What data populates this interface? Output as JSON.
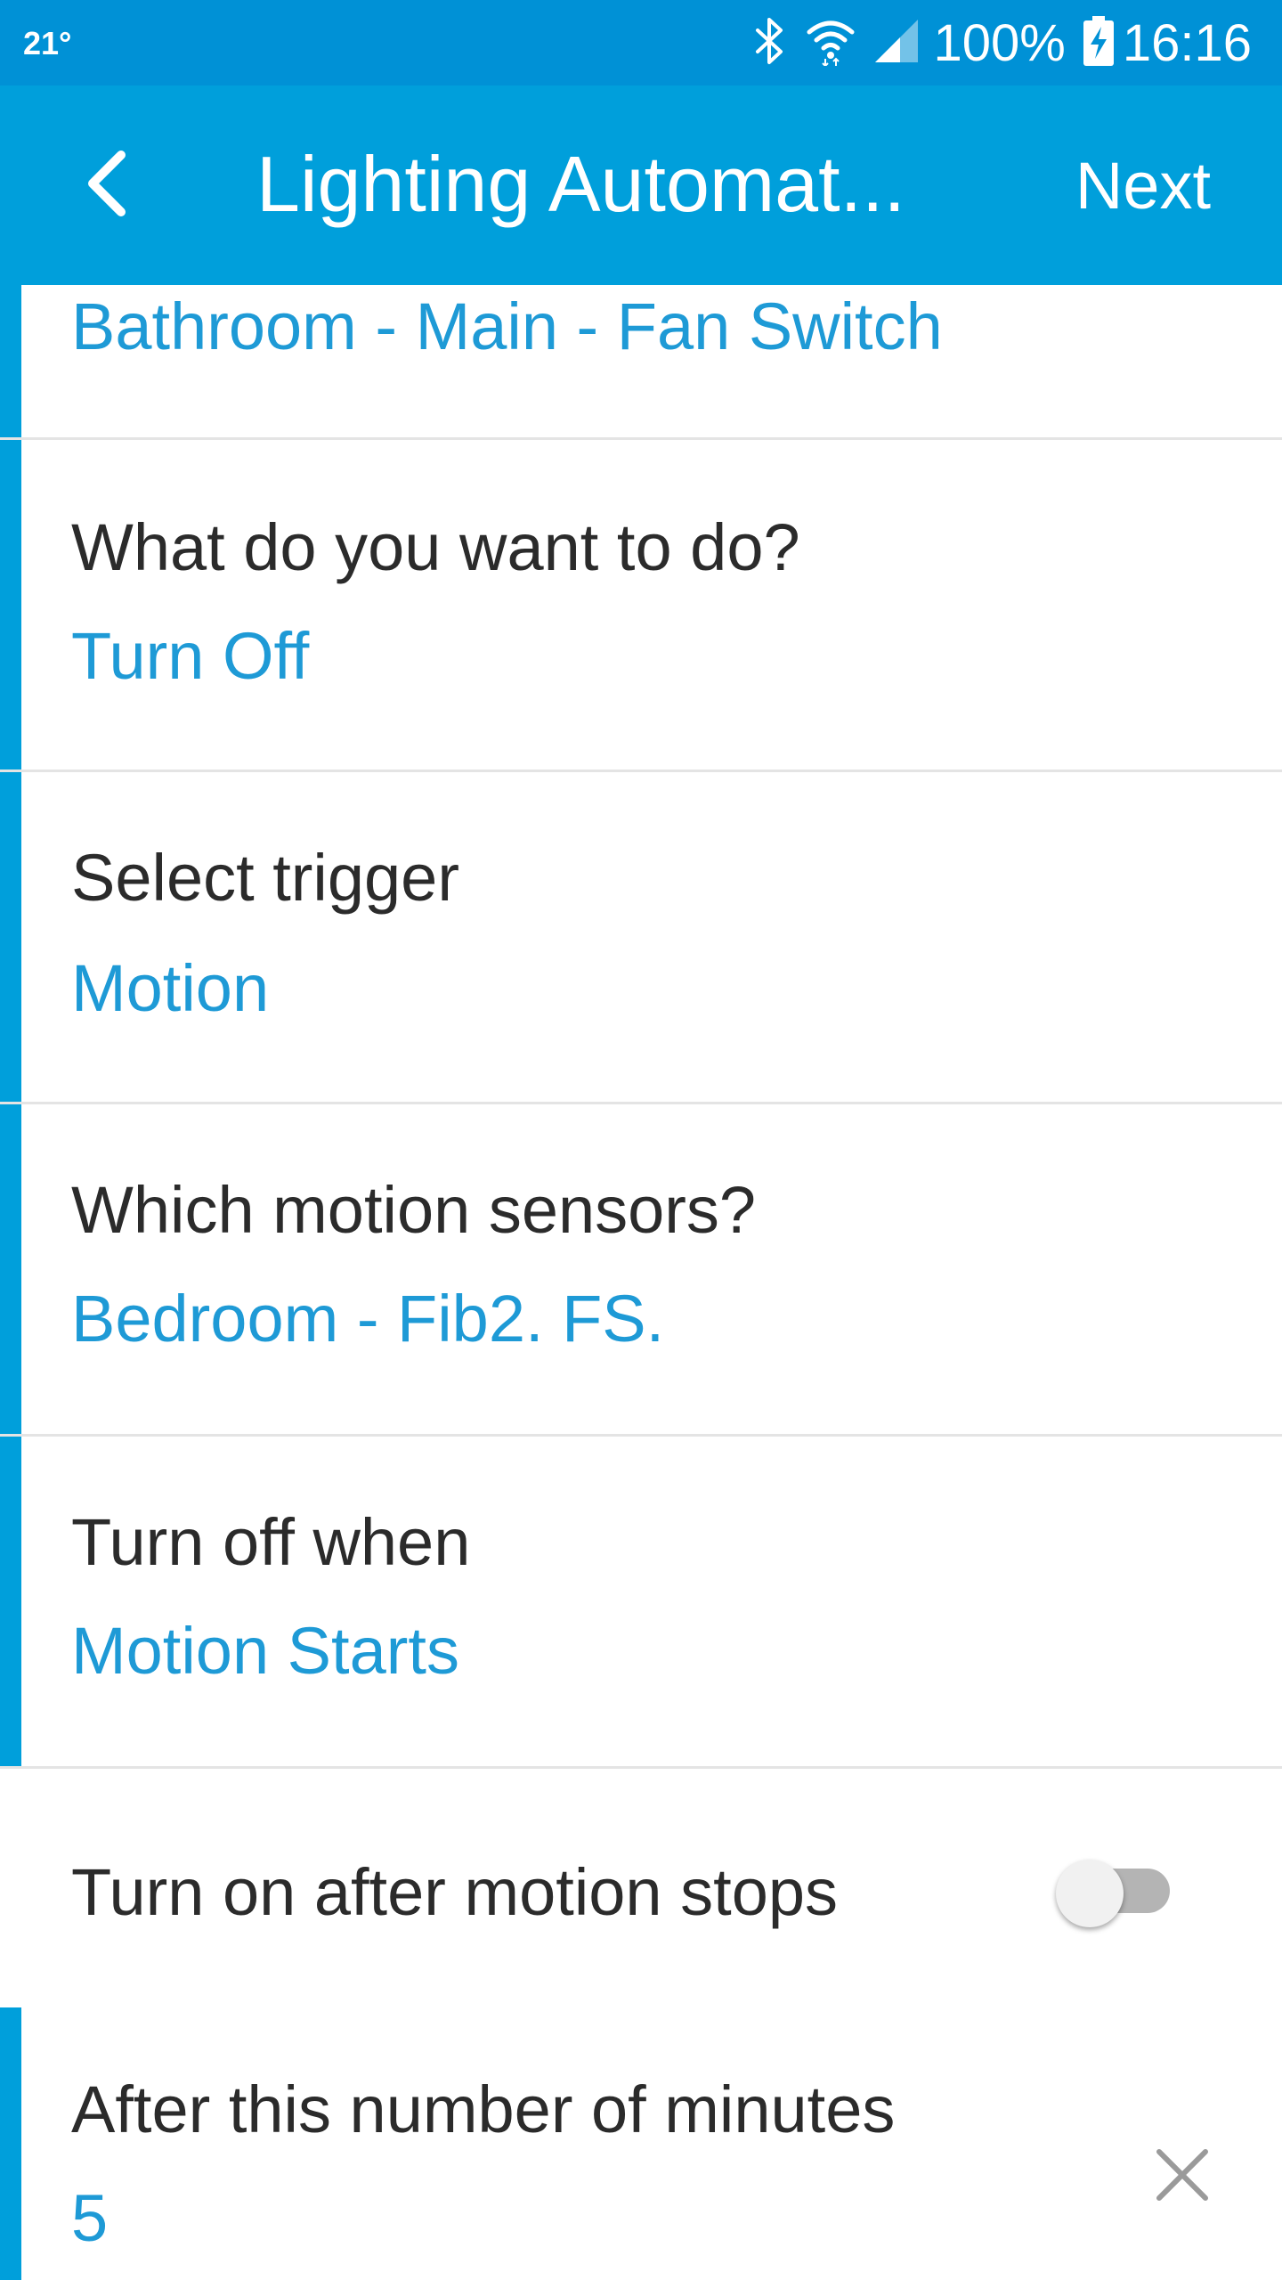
{
  "status_bar": {
    "temperature": "21°",
    "battery_percent": "100%",
    "time": "16:16",
    "icons": [
      "bluetooth-icon",
      "wifi-icon",
      "signal-icon",
      "battery-charging-icon"
    ]
  },
  "app_bar": {
    "back_icon": "chevron-left-icon",
    "title": "Lighting Automat...",
    "next_label": "Next"
  },
  "colors": {
    "status_bar": "#0091d6",
    "app_bar": "#009fdb",
    "accent": "#009fdb",
    "value_text": "#1e9ad6",
    "label_text": "#2b2b2b",
    "divider": "#e4e4e4"
  },
  "form": {
    "device_row": {
      "value": "Bathroom - Main - Fan Switch"
    },
    "action_row": {
      "label": "What do you want to do?",
      "value": "Turn Off"
    },
    "trigger_row": {
      "label": "Select trigger",
      "value": "Motion"
    },
    "sensors_row": {
      "label": "Which motion sensors?",
      "value": "Bedroom - Fib2. FS."
    },
    "condition_row": {
      "label": "Turn off when",
      "value": "Motion Starts"
    },
    "toggle_row": {
      "label": "Turn on after motion stops",
      "toggle_state": "off"
    },
    "minutes_row": {
      "label": "After this number of minutes",
      "value": "5",
      "clear_icon": "close-icon"
    }
  }
}
